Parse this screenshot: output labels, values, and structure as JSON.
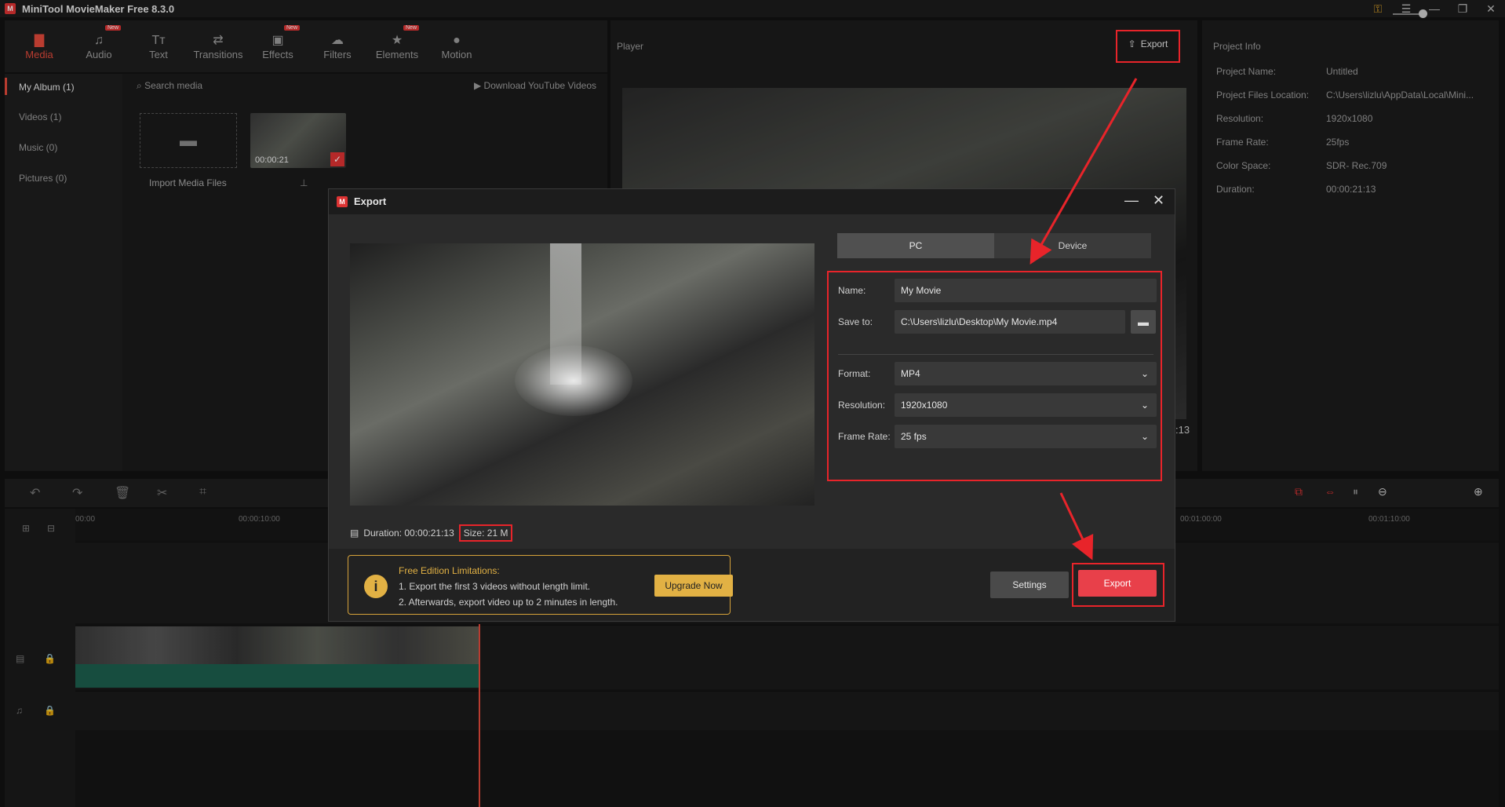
{
  "app": {
    "title": "MiniTool MovieMaker Free 8.3.0",
    "logo_text": "M"
  },
  "window_controls": [
    "⚿",
    "☰",
    "—",
    "❐",
    "✕"
  ],
  "toolbar": {
    "tools": [
      {
        "label": "Media",
        "icon": "media-icon",
        "active": true,
        "new": false
      },
      {
        "label": "Audio",
        "icon": "audio-icon",
        "active": false,
        "new": true
      },
      {
        "label": "Text",
        "icon": "text-icon",
        "active": false,
        "new": false
      },
      {
        "label": "Transitions",
        "icon": "transitions-icon",
        "active": false,
        "new": false
      },
      {
        "label": "Effects",
        "icon": "effects-icon",
        "active": false,
        "new": true
      },
      {
        "label": "Filters",
        "icon": "filters-icon",
        "active": false,
        "new": false
      },
      {
        "label": "Elements",
        "icon": "elements-icon",
        "active": false,
        "new": true
      },
      {
        "label": "Motion",
        "icon": "motion-icon",
        "active": false,
        "new": false
      }
    ],
    "new_badge": "New"
  },
  "media": {
    "albums": [
      "My Album (1)",
      "Videos (1)",
      "Music (0)",
      "Pictures (0)"
    ],
    "search_placeholder": "Search media",
    "youtube_link": "Download YouTube Videos",
    "import_label": "Import Media Files",
    "thumb_duration": "00:00:21"
  },
  "player": {
    "title": "Player",
    "export_label": "Export",
    "time_fragment": ":13"
  },
  "project_info": {
    "title": "Project Info",
    "rows": [
      {
        "label": "Project Name:",
        "value": "Untitled"
      },
      {
        "label": "Project Files Location:",
        "value": "C:\\Users\\lizlu\\AppData\\Local\\Mini..."
      },
      {
        "label": "Resolution:",
        "value": "1920x1080"
      },
      {
        "label": "Frame Rate:",
        "value": "25fps"
      },
      {
        "label": "Color Space:",
        "value": "SDR- Rec.709"
      },
      {
        "label": "Duration:",
        "value": "00:00:21:13"
      }
    ]
  },
  "timeline": {
    "ruler": [
      "00:00",
      "00:00:10:00",
      "00:01:00:00",
      "00:01:10:00"
    ]
  },
  "dialog": {
    "title": "Export",
    "tabs": [
      "PC",
      "Device"
    ],
    "active_tab": "PC",
    "name_label": "Name:",
    "name_value": "My Movie",
    "save_label": "Save to:",
    "save_value": "C:\\Users\\lizlu\\Desktop\\My Movie.mp4",
    "format_label": "Format:",
    "format_value": "MP4",
    "resolution_label": "Resolution:",
    "resolution_value": "1920x1080",
    "framerate_label": "Frame Rate:",
    "framerate_value": "25 fps",
    "duration_text": "Duration:  00:00:21:13",
    "size_text": "Size:  21 M",
    "notice_title": "Free Edition Limitations:",
    "notice_line1": "1. Export the first 3 videos without length limit.",
    "notice_line2": "2. Afterwards, export video up to 2 minutes in length.",
    "upgrade_label": "Upgrade Now",
    "settings_label": "Settings",
    "export_label": "Export"
  },
  "colors": {
    "accent": "#e24a3b",
    "highlight": "#e8242a",
    "notice": "#e2b144"
  }
}
